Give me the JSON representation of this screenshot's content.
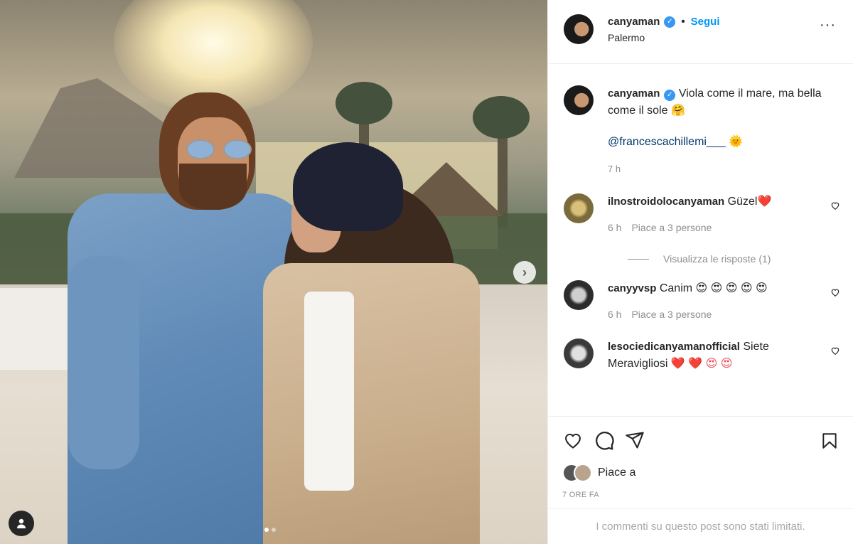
{
  "post": {
    "author": "canyaman",
    "follow_label": "Segui",
    "separator": "•",
    "location": "Palermo",
    "more_icon": "···"
  },
  "caption": {
    "username": "canyaman",
    "text_line1": "Viola come il mare, ma",
    "text_line2": "bella come il sole",
    "emoji": "🤗",
    "mention": "@francescachillemi___",
    "mention_emoji": "🌞",
    "time": "7 h"
  },
  "comments": [
    {
      "username": "ilnostroidolocanyaman",
      "text": "Güzel",
      "emoji": "❤️",
      "time": "6 h",
      "likes": "Piace a 3 persone"
    },
    {
      "username": "canyyvsp",
      "text": "Canim",
      "emoji": "😍 😍 😍 😍 😍",
      "time": "6 h",
      "likes": "Piace a 3 persone"
    },
    {
      "username": "lesociedicanyamanofficial",
      "text": "Siete",
      "text2": "Meravigliosi",
      "emoji": "❤️ ❤️ 😍 😍"
    }
  ],
  "replies_label": "Visualizza le risposte (1)",
  "actions": {
    "likes_label": "Piace a",
    "timestamp": "7 ORE FA",
    "limited_notice": "I commenti su questo post sono stati limitati."
  },
  "media": {
    "next_icon": "›",
    "carousel_pages": 2,
    "carousel_active": 1
  },
  "colors": {
    "link": "#0095f6",
    "verified": "#3897f0",
    "like_red": "#ed4956"
  }
}
